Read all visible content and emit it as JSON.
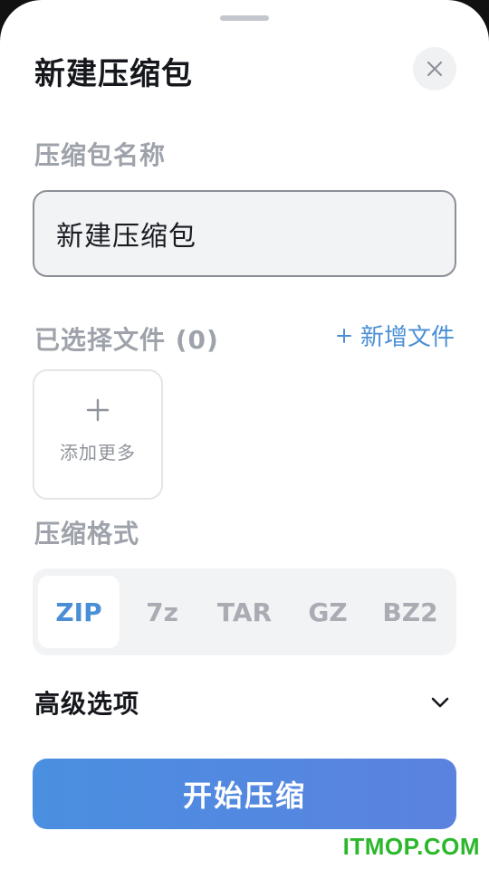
{
  "sheet": {
    "title": "新建压缩包"
  },
  "archive_name": {
    "label": "压缩包名称",
    "value": "新建压缩包"
  },
  "files": {
    "label": "已选择文件 (0)",
    "add_link_label": "新增文件",
    "add_more_label": "添加更多"
  },
  "format": {
    "label": "压缩格式",
    "options": [
      "ZIP",
      "7z",
      "TAR",
      "GZ",
      "BZ2"
    ],
    "selected": "ZIP"
  },
  "advanced": {
    "label": "高级选项"
  },
  "actions": {
    "start_label": "开始压缩"
  },
  "watermark": "ITMOP.COM",
  "colors": {
    "accent": "#4a8fd6",
    "muted_label": "#9ea2aa",
    "watermark": "#2bb82b"
  }
}
